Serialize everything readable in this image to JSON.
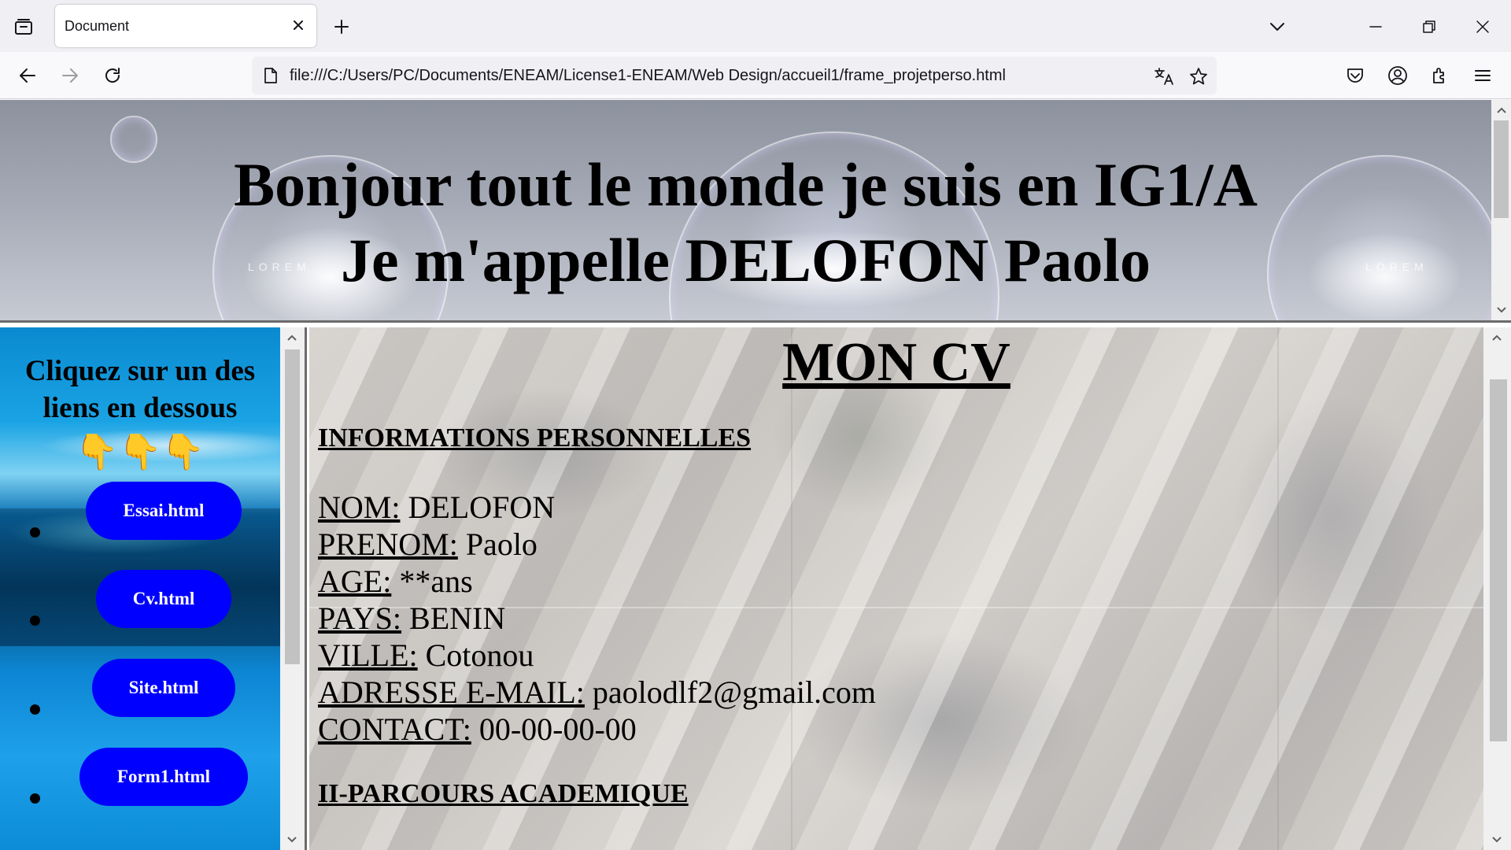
{
  "browser": {
    "tab_title": "Document",
    "url": "file:///C:/Users/PC/Documents/ENEAM/License1-ENEAM/Web Design/accueil1/frame_projetperso.html"
  },
  "banner": {
    "line1": "Bonjour tout le monde je suis en IG1/A",
    "line2": "Je m'appelle DELOFON Paolo",
    "watermark": "LOREM"
  },
  "sidebar": {
    "heading_line1": "Cliquez sur un des",
    "heading_line2": "liens en dessous",
    "emojis": "👇👇👇",
    "links": [
      {
        "label": "Essai.html"
      },
      {
        "label": "Cv.html"
      },
      {
        "label": "Site.html"
      },
      {
        "label": "Form1.html"
      }
    ]
  },
  "cv": {
    "title": "MON CV",
    "section1": "INFORMATIONS PERSONNELLES",
    "fields": [
      {
        "label": "NOM:",
        "value": " DELOFON"
      },
      {
        "label": "PRENOM:",
        "value": " Paolo"
      },
      {
        "label": "AGE:",
        "value": " **ans"
      },
      {
        "label": "PAYS:",
        "value": " BENIN"
      },
      {
        "label": "VILLE:",
        "value": " Cotonou"
      },
      {
        "label": "ADRESSE E-MAIL:",
        "value": " paolodlf2@gmail.com"
      },
      {
        "label": "CONTACT:",
        "value": " 00-00-00-00"
      }
    ],
    "section2": "II-PARCOURS ACADEMIQUE"
  }
}
